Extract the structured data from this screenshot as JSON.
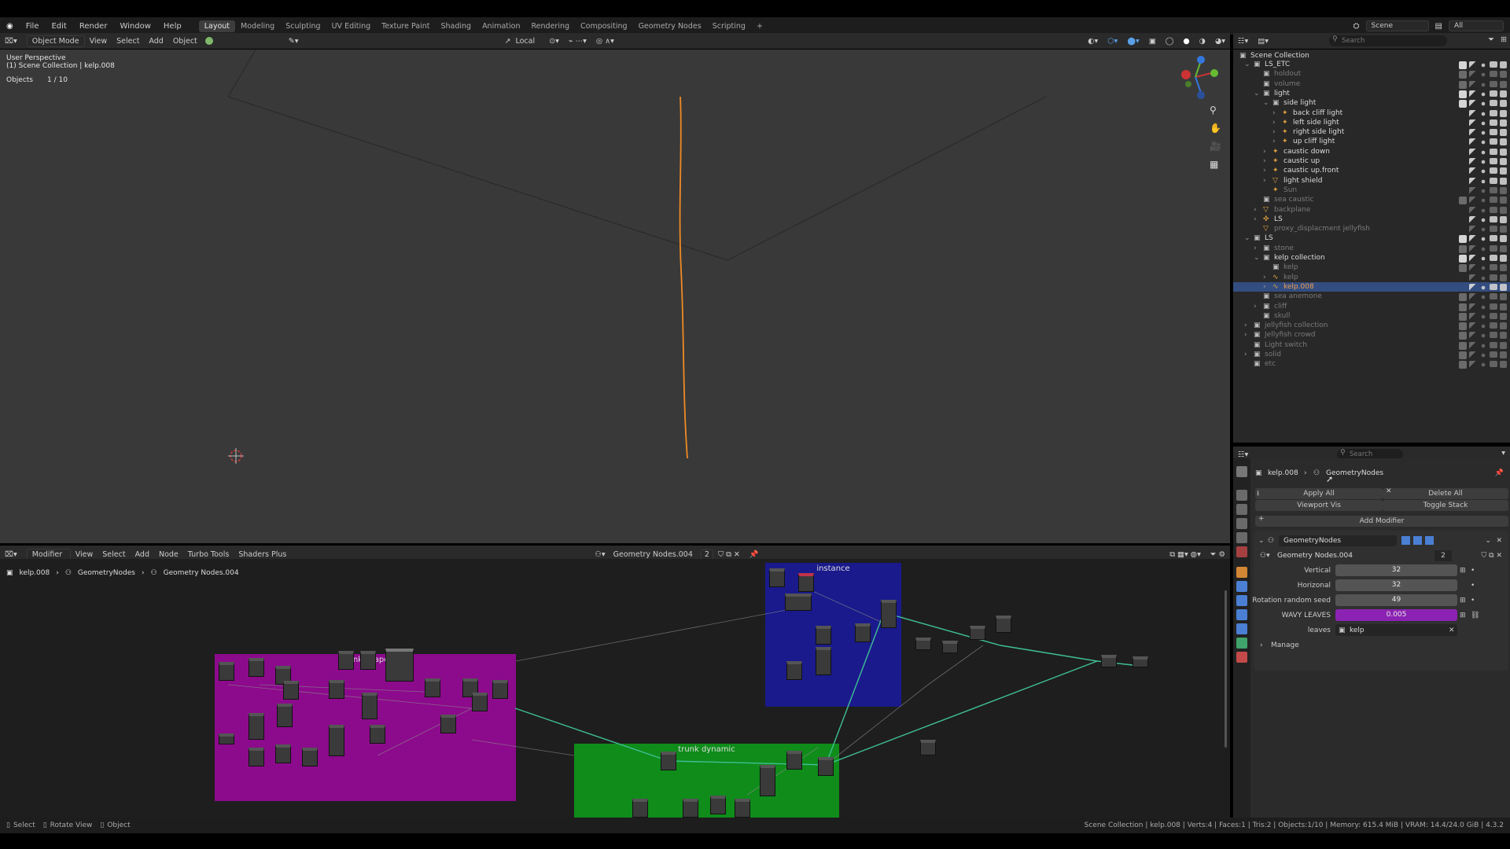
{
  "menu": [
    "File",
    "Edit",
    "Render",
    "Window",
    "Help"
  ],
  "workspaces": [
    "Layout",
    "Modeling",
    "Sculpting",
    "UV Editing",
    "Texture Paint",
    "Shading",
    "Animation",
    "Rendering",
    "Compositing",
    "Geometry Nodes",
    "Scripting"
  ],
  "active_workspace": "Layout",
  "scene": {
    "name": "Scene",
    "view_layer": "All"
  },
  "viewport": {
    "mode": "Object Mode",
    "menus": [
      "View",
      "Select",
      "Add",
      "Object"
    ],
    "transform": "Local",
    "info_line1": "User Perspective",
    "info_line2": "(1) Scene Collection | kelp.008",
    "objects_label": "Objects",
    "objects_count": "1 / 10"
  },
  "outliner": {
    "search_placeholder": "Search",
    "root": "Scene Collection",
    "rows": [
      {
        "label": "LS_ETC",
        "dim": false
      },
      {
        "label": "holdout",
        "dim": true
      },
      {
        "label": "volume",
        "dim": true
      },
      {
        "label": "light",
        "dim": false
      },
      {
        "label": "side light",
        "dim": false
      },
      {
        "label": "back cliff light",
        "dim": false
      },
      {
        "label": "left side light",
        "dim": false
      },
      {
        "label": "right side light",
        "dim": false
      },
      {
        "label": "up cliff light",
        "dim": false
      },
      {
        "label": "caustic down",
        "dim": false
      },
      {
        "label": "caustic up",
        "dim": false
      },
      {
        "label": "caustic up.front",
        "dim": false
      },
      {
        "label": "light shield",
        "dim": false
      },
      {
        "label": "Sun",
        "dim": true
      },
      {
        "label": "sea caustic",
        "dim": true
      },
      {
        "label": "backplane",
        "dim": true
      },
      {
        "label": "LS",
        "dim": false
      },
      {
        "label": "proxy_displacment jellyfish",
        "dim": true
      },
      {
        "label": "LS",
        "dim": false
      },
      {
        "label": "stone",
        "dim": true
      },
      {
        "label": "kelp collection",
        "dim": false
      },
      {
        "label": "kelp",
        "dim": true
      },
      {
        "label": "kelp",
        "dim": true
      },
      {
        "label": "kelp.008",
        "dim": false,
        "selected": true
      },
      {
        "label": "sea anemone",
        "dim": true
      },
      {
        "label": "cliff",
        "dim": true
      },
      {
        "label": "skull",
        "dim": true
      },
      {
        "label": "jellyfish collection",
        "dim": true
      },
      {
        "label": "Jellyfish crowd",
        "dim": true
      },
      {
        "label": "Light switch",
        "dim": true
      },
      {
        "label": "solid",
        "dim": true
      },
      {
        "label": "etc",
        "dim": true
      }
    ]
  },
  "properties": {
    "search_placeholder": "Search",
    "breadcrumb_object": "kelp.008",
    "breadcrumb_modifier": "GeometryNodes",
    "apply_all": "Apply All",
    "delete_all": "Delete All",
    "viewport_vis": "Viewport Vis",
    "toggle_stack": "Toggle Stack",
    "add_modifier": "Add Modifier",
    "modifier_name": "GeometryNodes",
    "node_group": "Geometry Nodes.004",
    "node_group_users": "2",
    "inputs": [
      {
        "label": "Vertical",
        "value": "32"
      },
      {
        "label": "Horizonal",
        "value": "32"
      },
      {
        "label": "Rotation random seed",
        "value": "49"
      },
      {
        "label": "WAVY LEAVES",
        "value": "0.005"
      }
    ],
    "leaves_label": "leaves",
    "leaves_value": "kelp",
    "manage": "Manage"
  },
  "node_editor": {
    "editor": "Modifier",
    "menus": [
      "View",
      "Select",
      "Add",
      "Node",
      "Turbo Tools",
      "Shaders Plus"
    ],
    "node_group": "Geometry Nodes.004",
    "users": "2",
    "breadcrumb": [
      "kelp.008",
      "GeometryNodes",
      "Geometry Nodes.004"
    ],
    "frames": [
      {
        "label": "instance",
        "color": "#1a1a8c"
      },
      {
        "label": "trunk shape",
        "color": "#8c0a8c"
      },
      {
        "label": "trunk dynamic",
        "color": "#0f8c1a"
      }
    ]
  },
  "statusbar": {
    "select": "Select",
    "rotate": "Rotate View",
    "object": "Object",
    "info": "Scene Collection | kelp.008 | Verts:4 | Faces:1 | Tris:2 | Objects:1/10 | Memory: 615.4 MiB | VRAM: 14.4/24.0 GiB | 4.3.2"
  },
  "colors": {
    "selection": "#334d80",
    "accent_orange": "#f08a24",
    "wavy_bar": "#8c22b3"
  }
}
